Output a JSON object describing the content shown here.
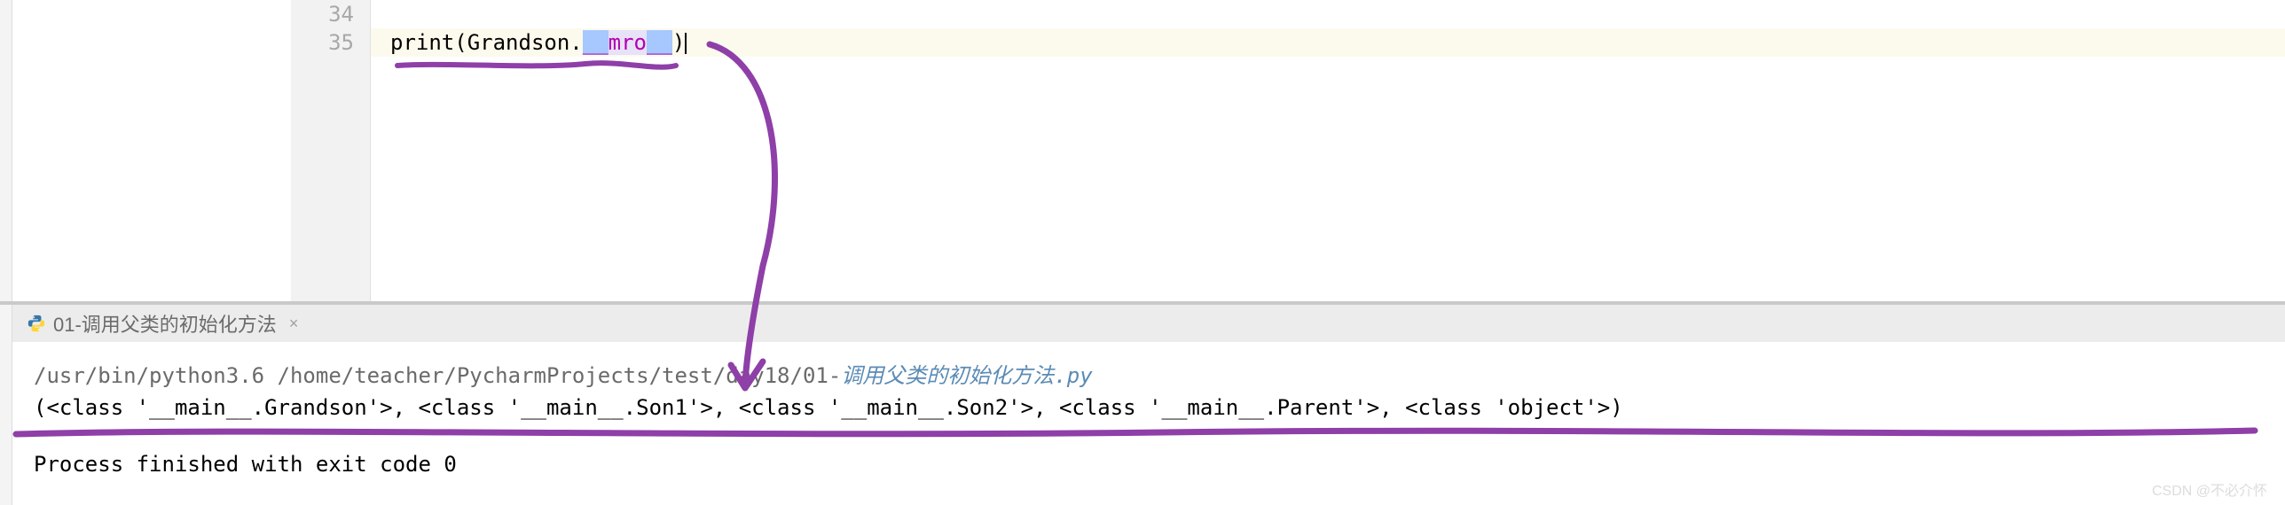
{
  "editor": {
    "lines": [
      {
        "num": "34",
        "current": false,
        "tokens": []
      },
      {
        "num": "35",
        "current": true,
        "tokens": [
          {
            "cls": "tok-call",
            "t": "print"
          },
          {
            "cls": "tok-paren",
            "t": "("
          },
          {
            "cls": "tok-name",
            "t": "Grandson"
          },
          {
            "cls": "tok-dot",
            "t": "."
          },
          {
            "cls": "tok-magic sel",
            "t": "__"
          },
          {
            "cls": "tok-magic",
            "t": "mro"
          },
          {
            "cls": "tok-magic sel",
            "t": "__"
          },
          {
            "cls": "tok-paren",
            "t": ")"
          }
        ]
      }
    ]
  },
  "tab": {
    "label": "01-调用父类的初始化方法",
    "close": "×"
  },
  "console": {
    "cmd_en": "/usr/bin/python3.6 /home/teacher/PycharmProjects/test/day18/01-",
    "cmd_cn": "调用父类的初始化方法",
    "cmd_ext": ".py",
    "output": "(<class '__main__.Grandson'>, <class '__main__.Son1'>, <class '__main__.Son2'>, <class '__main__.Parent'>, <class 'object'>)",
    "exit": "Process finished with exit code 0"
  },
  "watermark": "CSDN @不必介怀"
}
